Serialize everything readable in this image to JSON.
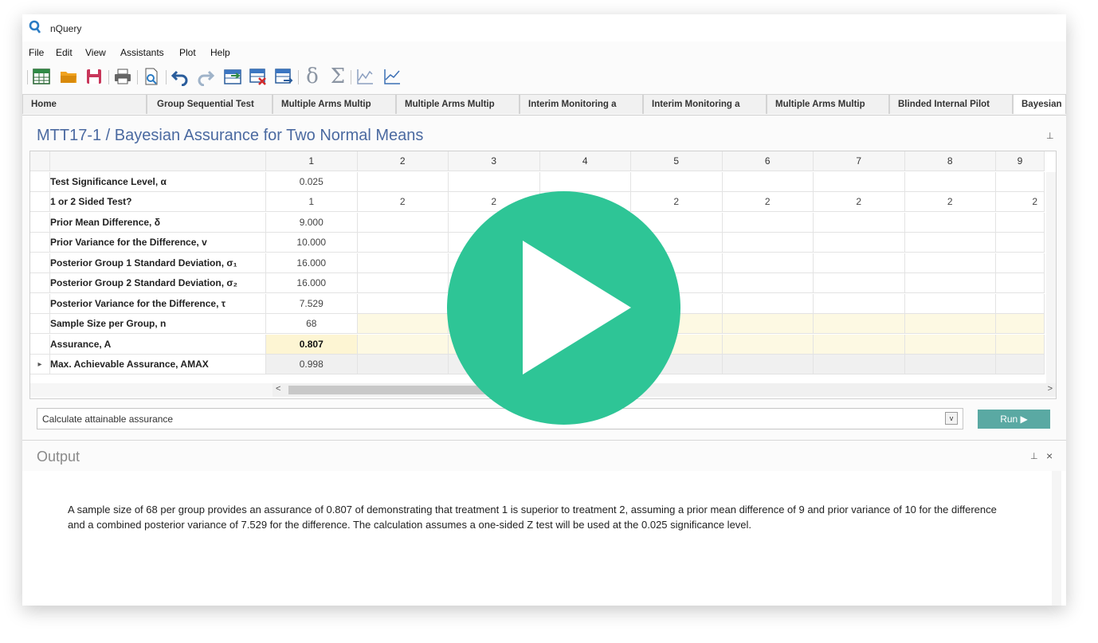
{
  "app": {
    "title": "nQuery"
  },
  "menu": [
    "File",
    "Edit",
    "View",
    "Assistants",
    "Plot",
    "Help"
  ],
  "toolbar_icons": [
    "new-table-icon",
    "open-folder-icon",
    "save-icon",
    "print-icon",
    "print-preview-icon",
    "undo-icon",
    "redo-icon",
    "insert-rows-icon",
    "delete-table-icon",
    "export-table-icon",
    "delta-icon",
    "sigma-icon",
    "line-chart-icon",
    "area-chart-icon"
  ],
  "toolbar_glyphs": {
    "delta": "δ",
    "sigma": "Σ"
  },
  "tabs": [
    "Home",
    "Group Sequential Test",
    "Multiple Arms Multip",
    "Multiple Arms Multip",
    "Interim Monitoring a",
    "Interim Monitoring a",
    "Multiple Arms Multip",
    "Blinded Internal Pilot",
    "Bayesian"
  ],
  "active_tab_index": 8,
  "doc": {
    "title": "MTT17-1 / Bayesian Assurance for Two Normal Means"
  },
  "grid": {
    "columns": [
      "1",
      "2",
      "3",
      "4",
      "5",
      "6",
      "7",
      "8",
      "9"
    ],
    "rows": [
      {
        "label": "Test Significance Level, α",
        "values": [
          "0.025",
          "",
          "",
          "",
          "",
          "",
          "",
          "",
          ""
        ]
      },
      {
        "label": "1 or 2 Sided Test?",
        "values": [
          "1",
          "2",
          "2",
          "",
          "2",
          "2",
          "2",
          "2",
          "2"
        ]
      },
      {
        "label": "Prior Mean Difference, δ",
        "values": [
          "9.000",
          "",
          "",
          "",
          "",
          "",
          "",
          "",
          ""
        ]
      },
      {
        "label": "Prior Variance for the Difference, v",
        "values": [
          "10.000",
          "",
          "",
          "",
          "",
          "",
          "",
          "",
          ""
        ]
      },
      {
        "label": "Posterior Group 1 Standard Deviation, σ₁",
        "values": [
          "16.000",
          "",
          "",
          "",
          "",
          "",
          "",
          "",
          ""
        ]
      },
      {
        "label": "Posterior Group 2 Standard Deviation, σ₂",
        "values": [
          "16.000",
          "",
          "",
          "",
          "",
          "",
          "",
          "",
          ""
        ]
      },
      {
        "label": "Posterior Variance for the Difference, τ",
        "values": [
          "7.529",
          "",
          "",
          "",
          "",
          "",
          "",
          "",
          ""
        ]
      },
      {
        "label": "Sample Size per Group, n",
        "values": [
          "68",
          "",
          "",
          "",
          "",
          "",
          "",
          "",
          ""
        ]
      },
      {
        "label": "Assurance, A",
        "values": [
          "0.807",
          "",
          "",
          "",
          "",
          "",
          "",
          "",
          ""
        ]
      },
      {
        "label": "Max. Achievable Assurance, AMAX",
        "values": [
          "0.998",
          "",
          "",
          "",
          "",
          "",
          "",
          "",
          ""
        ]
      }
    ]
  },
  "command": {
    "text": "Calculate attainable assurance",
    "run_label": "Run ▶"
  },
  "output": {
    "title": "Output",
    "text": "A sample size of 68 per group provides an assurance of 0.807 of demonstrating that treatment 1 is superior to treatment 2, assuming a prior mean difference of 9 and prior variance of 10 for the difference and a combined posterior variance of 7.529 for the difference. The calculation assumes a one-sided Z test will be used at the 0.025 significance level."
  },
  "colors": {
    "accent": "#4b6aa1",
    "run": "#5aa9a3",
    "play": "#2ec596",
    "highlight": "#fdf9e3",
    "assurance_cell": "#fdf5d3"
  },
  "glyphs": {
    "scroll_left": "<",
    "scroll_right": ">",
    "pin": "⊥",
    "close": "×",
    "dropdown": "v",
    "row_marker": "▸"
  }
}
